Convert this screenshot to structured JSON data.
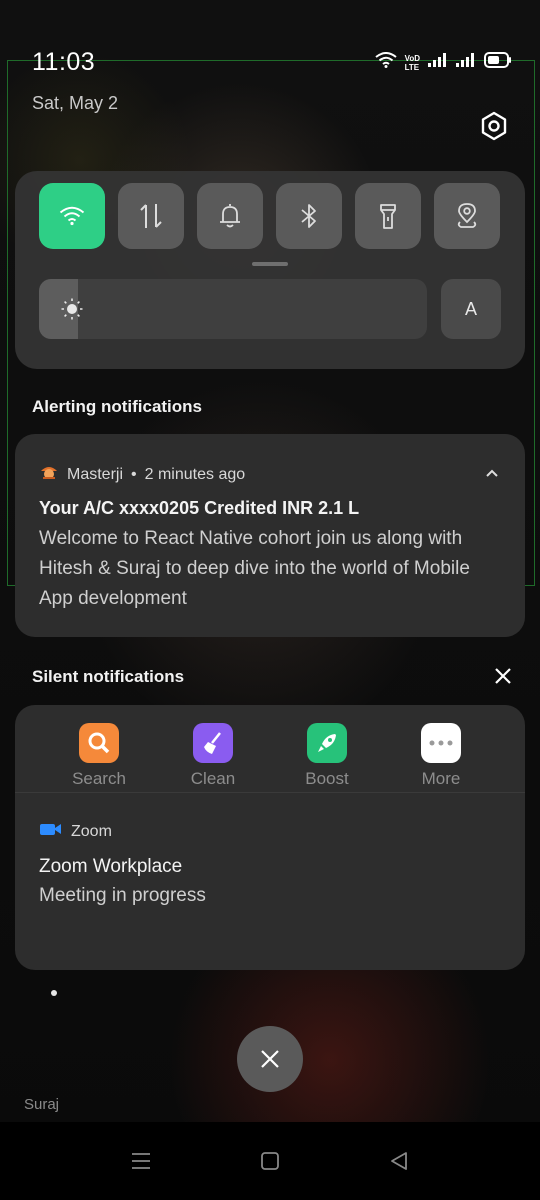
{
  "status_bar": {
    "time": "11:03",
    "date": "Sat, May 2",
    "carrier_badge_top": "VoD",
    "carrier_badge_bottom": "LTE"
  },
  "quick_settings": {
    "tiles": [
      {
        "name": "wifi",
        "icon": "wifi-icon",
        "active": true
      },
      {
        "name": "mobile-data",
        "icon": "data-arrows-icon",
        "active": false
      },
      {
        "name": "sound",
        "icon": "bell-icon",
        "active": false
      },
      {
        "name": "bluetooth",
        "icon": "bluetooth-icon",
        "active": false
      },
      {
        "name": "flashlight",
        "icon": "flashlight-icon",
        "active": false
      },
      {
        "name": "location",
        "icon": "location-icon",
        "active": false
      }
    ],
    "brightness_level": 0.1,
    "auto_label": "A",
    "active_color": "#2ecf86"
  },
  "alerting": {
    "section_label": "Alerting notifications",
    "notification": {
      "app": "Masterji",
      "separator": "•",
      "time": "2 minutes ago",
      "title": "Your A/C xxxx0205 Credited INR 2.1 L",
      "body": "Welcome to React Native cohort join us along with Hitesh & Suraj to deep dive into the world of Mobile App development"
    }
  },
  "silent": {
    "section_label": "Silent notifications",
    "shortcuts": [
      {
        "label": "Search",
        "icon": "search-icon",
        "color": "#f5893a"
      },
      {
        "label": "Clean",
        "icon": "broom-icon",
        "color": "#8a5cf0"
      },
      {
        "label": "Boost",
        "icon": "rocket-icon",
        "color": "#27c27a"
      },
      {
        "label": "More",
        "icon": "more-dots-icon",
        "color": "#ffffff"
      }
    ],
    "notification": {
      "app": "Zoom",
      "title": "Zoom Workplace",
      "body": "Meeting in progress"
    }
  },
  "wallpaper_caption": "Suraj"
}
